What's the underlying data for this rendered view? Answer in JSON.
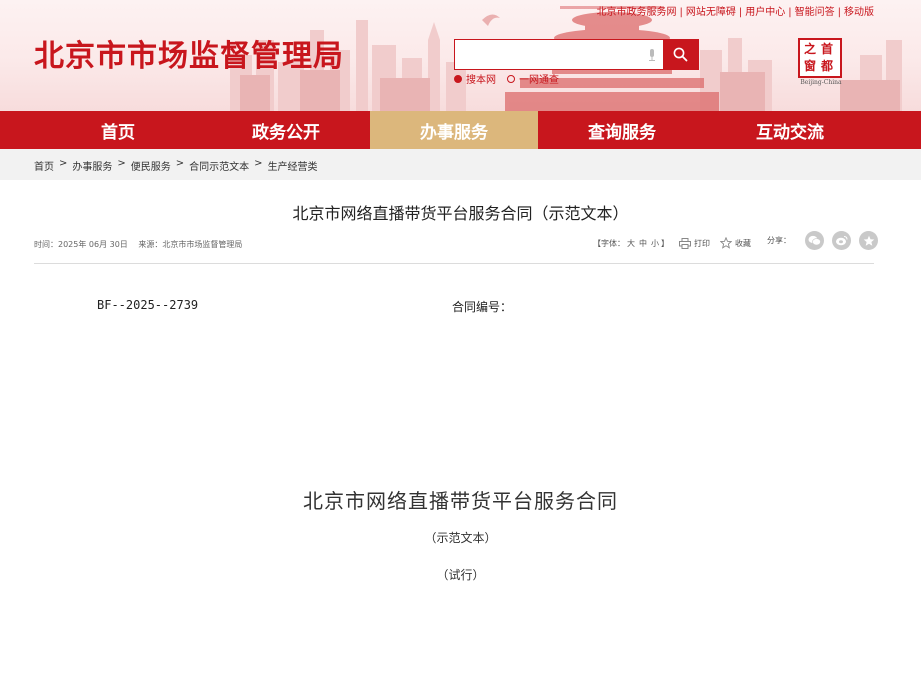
{
  "header": {
    "site_title": "北京市市场监督管理局",
    "top_links": [
      "北京市政务服务网",
      "网站无障碍",
      "用户中心",
      "智能问答",
      "移动版"
    ],
    "search": {
      "placeholder": ""
    },
    "search_scopes": [
      {
        "label": "搜本网",
        "selected": true
      },
      {
        "label": "一网通查",
        "selected": false
      }
    ],
    "logo": {
      "chars": [
        "首",
        "都",
        "之",
        "窗"
      ],
      "caption": "Beijing-China"
    }
  },
  "nav": {
    "items": [
      {
        "label": "首页",
        "active": false
      },
      {
        "label": "政务公开",
        "active": false
      },
      {
        "label": "办事服务",
        "active": true
      },
      {
        "label": "查询服务",
        "active": false
      },
      {
        "label": "互动交流",
        "active": false
      }
    ]
  },
  "breadcrumb": [
    "首页",
    "办事服务",
    "便民服务",
    "合同示范文本",
    "生产经营类"
  ],
  "article": {
    "title": "北京市网络直播带货平台服务合同（示范文本）",
    "time": "时间：2025年 06月 30日",
    "source": "来源：北京市市场监督管理局",
    "font_size_label": "【字体：",
    "font_sizes": [
      "大",
      "中",
      "小"
    ],
    "font_size_end": "】",
    "print_label": "打印",
    "favorite_label": "收藏",
    "share_label": "分享："
  },
  "document": {
    "contract_number": "BF--2025--2739",
    "contract_number_label": "合同编号：",
    "title": "北京市网络直播带货平台服务合同",
    "subtitle": "（示范文本）",
    "trial": "（试行）"
  },
  "colors": {
    "brand_red": "#c8161d",
    "nav_active": "#dcb77c",
    "crumb_bg": "#f2f2f2"
  }
}
